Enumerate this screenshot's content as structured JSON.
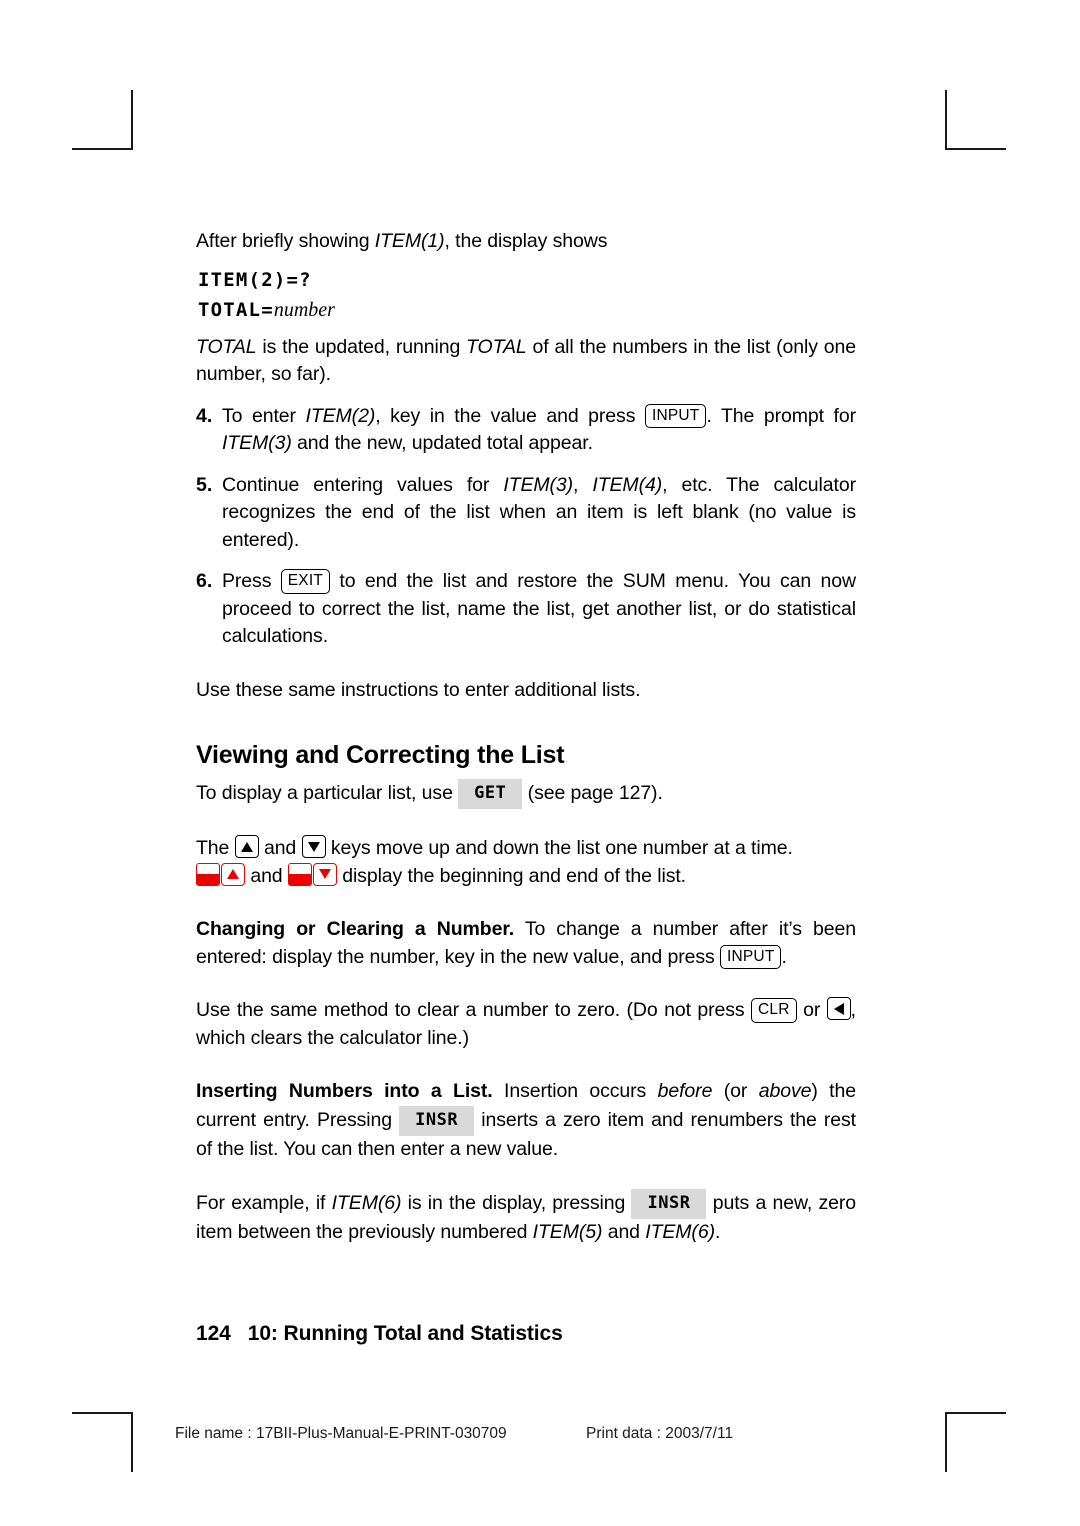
{
  "page": {
    "number": "124",
    "chapter": "10: Running Total and Statistics"
  },
  "slug": {
    "file": "File name : 17BII-Plus-Manual-E-PRINT-030709",
    "date": "Print data : 2003/7/11"
  },
  "intro": {
    "lead_1": "After briefly showing ",
    "lead_item": "ITEM(1)",
    "lead_2": ", the display shows",
    "display_line_1": "ITEM(2)=?",
    "display_line_2_label": "TOTAL=",
    "display_line_2_value": "number",
    "total_p_1": "TOTAL",
    "total_p_2": " is the updated, running ",
    "total_p_3": "TOTAL",
    "total_p_4": " of all the numbers in the list (only one number, so far)."
  },
  "steps": [
    {
      "num": "4.",
      "t1": "To enter ",
      "i1": "ITEM(2)",
      "t2": ", key in the value and press ",
      "key": "INPUT",
      "t3": ". The prompt for ",
      "i2": "ITEM(3)",
      "t4": " and the new, updated total appear."
    },
    {
      "num": "5.",
      "t1": "Continue entering values for ",
      "i1": "ITEM(3)",
      "t2": ", ",
      "i2": "ITEM(4)",
      "t3": ", etc. The calculator recognizes the end of the list when an item is left blank (no value is entered)."
    },
    {
      "num": "6.",
      "t1": "Press ",
      "key": "EXIT",
      "t2": " to end the list and restore the SUM menu. You can now proceed to correct the list, name the list, get another list, or do statistical calculations."
    }
  ],
  "additional_lists": "Use these same instructions to enter additional lists.",
  "section": {
    "heading": "Viewing and Correcting the List",
    "get_1": "To display a particular list, use ",
    "get_key": "GET",
    "get_2": " (see page 127)."
  },
  "arrows": {
    "t1": "The ",
    "t2": " and ",
    "t3": " keys move up and down the list one number at a time. ",
    "t4": " and ",
    "t5": " display the beginning and end of the list."
  },
  "changing": {
    "title": "Changing or Clearing a Number.",
    "t1": " To change a number after it’s been entered: display the number, key in the new value, and press ",
    "key": "INPUT",
    "t2": ".",
    "clear_1": "Use the same method to clear a number to zero. (Do not press ",
    "clear_key": "CLR",
    "clear_2": " or ",
    "clear_3": ", which clears the calculator line.)"
  },
  "inserting": {
    "title": "Inserting Numbers into a List.",
    "t1": " Insertion occurs ",
    "i1": "before",
    "t2": " (or ",
    "i2": "above",
    "t3": ") the current entry. Pressing ",
    "key": "INSR",
    "t4": " inserts a zero item and renumbers the rest of the list. You can then enter a new value.",
    "ex_1": "For example, if ",
    "ex_i1": "ITEM(6)",
    "ex_2": " is in the display, pressing ",
    "ex_key": "INSR",
    "ex_3": " puts a new, zero item between the previously numbered ",
    "ex_i2": "ITEM(5)",
    "ex_4": " and ",
    "ex_i3": "ITEM(6)",
    "ex_5": "."
  }
}
